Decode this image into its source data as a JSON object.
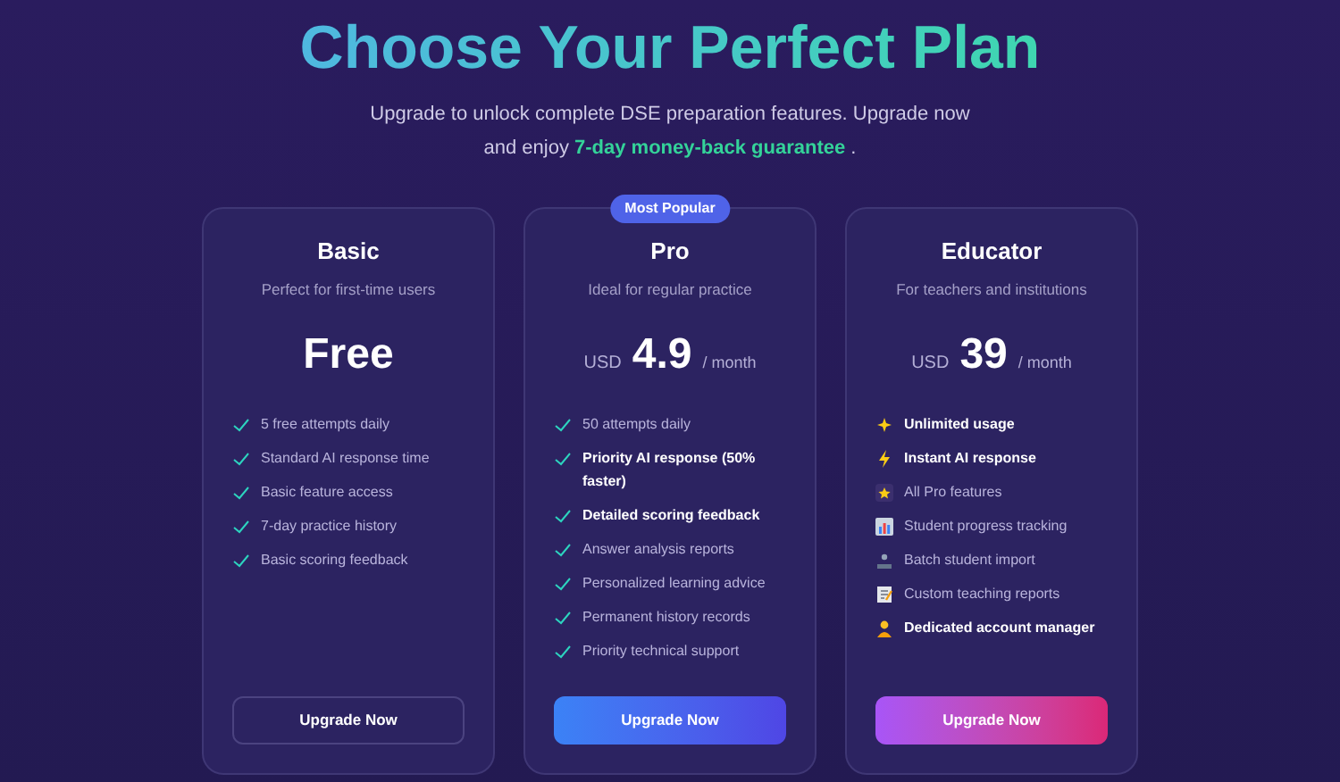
{
  "header": {
    "title": "Choose Your Perfect Plan",
    "subtitle": "Upgrade to unlock complete DSE preparation features. Upgrade now and enjoy **7-day money-back guarantee** ."
  },
  "plans": [
    {
      "name": "Basic",
      "tagline": "Perfect for first-time users",
      "price": "Free",
      "button": {
        "label": "Upgrade Now",
        "kind": "outline"
      },
      "features": [
        {
          "kind": "check",
          "text": "5 free attempts daily",
          "highlighted": false
        },
        {
          "kind": "check",
          "text": "Standard AI response time",
          "highlighted": false
        },
        {
          "kind": "check",
          "text": "Basic feature access",
          "highlighted": false
        },
        {
          "kind": "check",
          "text": "7-day practice history",
          "highlighted": false
        },
        {
          "kind": "check",
          "text": "Basic scoring feedback",
          "highlighted": false
        }
      ]
    },
    {
      "name": "Pro",
      "tagline": "Ideal for regular practice",
      "badge": "Most Popular",
      "currency": "USD",
      "price": "4.9",
      "period": "/ month",
      "button": {
        "label": "Upgrade Now",
        "kind": "blue"
      },
      "features": [
        {
          "kind": "check",
          "text": "50 attempts daily",
          "highlighted": false
        },
        {
          "kind": "check",
          "text": "Priority AI response (50% faster)",
          "highlighted": true
        },
        {
          "kind": "check",
          "text": "Detailed scoring feedback",
          "highlighted": true
        },
        {
          "kind": "check",
          "text": "Answer analysis reports",
          "highlighted": false
        },
        {
          "kind": "check",
          "text": "Personalized learning advice",
          "highlighted": false
        },
        {
          "kind": "check",
          "text": "Permanent history records",
          "highlighted": false
        },
        {
          "kind": "check",
          "text": "Priority technical support",
          "highlighted": false
        }
      ]
    },
    {
      "name": "Educator",
      "tagline": "For teachers and institutions",
      "currency": "USD",
      "price": "39",
      "period": "/ month",
      "button": {
        "label": "Upgrade Now",
        "kind": "pink"
      },
      "features": [
        {
          "kind": "sparkles",
          "text": "Unlimited usage",
          "highlighted": true
        },
        {
          "kind": "bolt",
          "text": "Instant AI response",
          "highlighted": true
        },
        {
          "kind": "star",
          "text": "All Pro features",
          "highlighted": false
        },
        {
          "kind": "chart",
          "text": "Student progress tracking",
          "highlighted": false
        },
        {
          "kind": "person-tray",
          "text": "Batch student import",
          "highlighted": false
        },
        {
          "kind": "memo",
          "text": "Custom teaching reports",
          "highlighted": false
        },
        {
          "kind": "person",
          "text": "Dedicated account manager",
          "highlighted": true
        }
      ]
    }
  ]
}
